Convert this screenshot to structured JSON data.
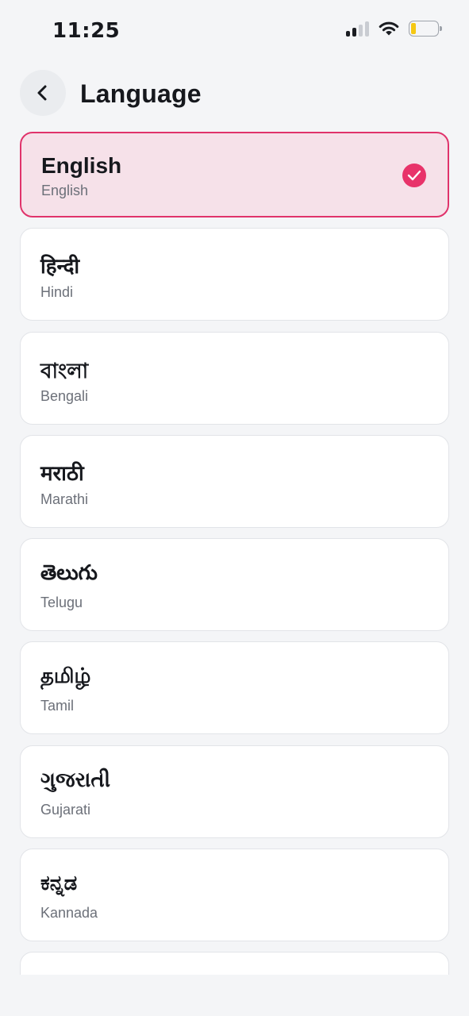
{
  "status_bar": {
    "time": "11:25"
  },
  "header": {
    "title": "Language"
  },
  "colors": {
    "accent": "#e8336a",
    "selected_bg": "#f6e1e9",
    "card_bg": "#ffffff"
  },
  "languages": [
    {
      "native": "English",
      "english": "English",
      "selected": true
    },
    {
      "native": "हिन्दी",
      "english": "Hindi",
      "selected": false
    },
    {
      "native": "বাংলা",
      "english": "Bengali",
      "selected": false
    },
    {
      "native": "मराठी",
      "english": "Marathi",
      "selected": false
    },
    {
      "native": "తెలుగు",
      "english": "Telugu",
      "selected": false
    },
    {
      "native": "தமிழ்",
      "english": "Tamil",
      "selected": false
    },
    {
      "native": "ગુજરાતી",
      "english": "Gujarati",
      "selected": false
    },
    {
      "native": "ಕನ್ನಡ",
      "english": "Kannada",
      "selected": false
    }
  ]
}
